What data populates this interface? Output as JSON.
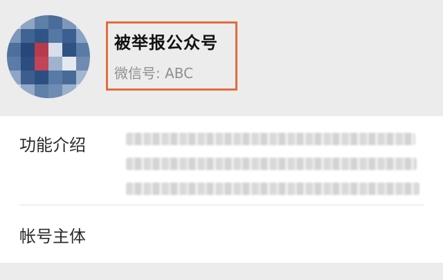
{
  "profile": {
    "account_name": "被举报公众号",
    "wechat_id": "微信号: ABC"
  },
  "details": {
    "intro_label": "功能介绍",
    "owner_label": "帐号主体"
  },
  "colors": {
    "highlight_border": "#e26b3b",
    "background": "#ececec",
    "card": "#ffffff"
  },
  "icons": {
    "avatar": "pixelated-avatar-icon"
  }
}
